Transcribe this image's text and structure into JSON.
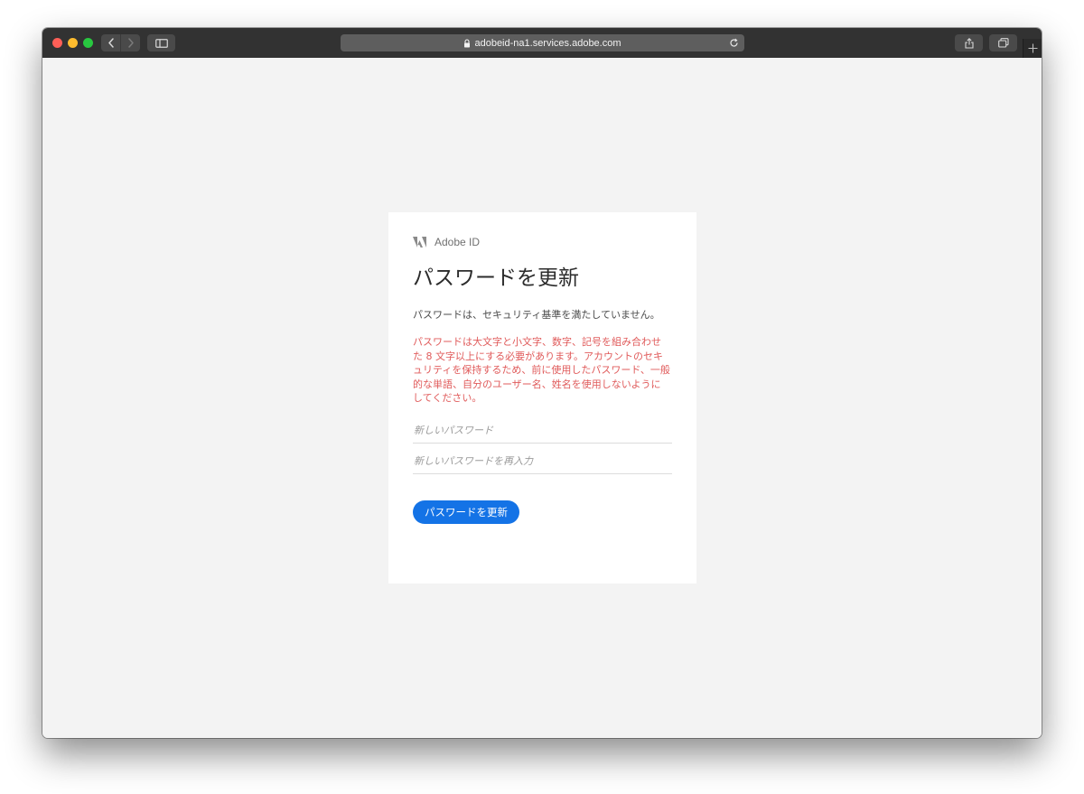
{
  "browser": {
    "url": "adobeid-na1.services.adobe.com",
    "traffic_lights": {
      "close": "#fe5f57",
      "minimize": "#febc2e",
      "zoom": "#28c840"
    }
  },
  "card": {
    "brand": "Adobe ID",
    "title": "パスワードを更新",
    "notice": "パスワードは、セキュリティ基準を満たしていません。",
    "requirements": "パスワードは大文字と小文字、数字、記号を組み合わせた 8 文字以上にする必要があります。アカウントのセキュリティを保持するため、前に使用したパスワード、一般的な単語、自分のユーザー名、姓名を使用しないようにしてください。",
    "new_password": {
      "placeholder": "新しいパスワード",
      "value": ""
    },
    "confirm_password": {
      "placeholder": "新しいパスワードを再入力",
      "value": ""
    },
    "submit_label": "パスワードを更新"
  },
  "colors": {
    "accent": "#1473e6",
    "error_text": "#e05b5b",
    "page_background": "#f3f3f3",
    "toolbar": "#323232"
  }
}
